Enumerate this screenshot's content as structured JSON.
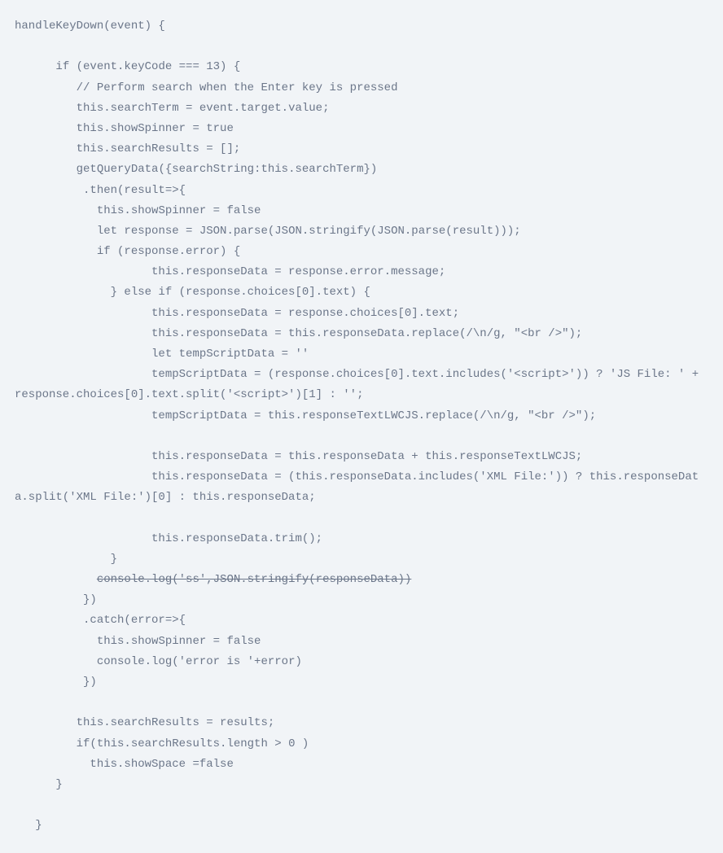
{
  "code": {
    "lines": [
      "handleKeyDown(event) {",
      "",
      "      if (event.keyCode === 13) {",
      "         // Perform search when the Enter key is pressed",
      "         this.searchTerm = event.target.value;",
      "         this.showSpinner = true",
      "         this.searchResults = [];",
      "         getQueryData({searchString:this.searchTerm})",
      "          .then(result=>{",
      "            this.showSpinner = false",
      "            let response = JSON.parse(JSON.stringify(JSON.parse(result)));",
      "            if (response.error) {",
      "                    this.responseData = response.error.message;",
      "              } else if (response.choices[0].text) {",
      "                    this.responseData = response.choices[0].text;",
      "                    this.responseData = this.responseData.replace(/\\n/g, \"<br />\");",
      "                    let tempScriptData = ''",
      "                    tempScriptData = (response.choices[0].text.includes('<script>')) ? 'JS File: ' + response.choices[0].text.split('<script>')[1] : '';",
      "                    tempScriptData = this.responseTextLWCJS.replace(/\\n/g, \"<br />\");",
      "",
      "                    this.responseData = this.responseData + this.responseTextLWCJS;",
      "                    this.responseData = (this.responseData.includes('XML File:')) ? this.responseData.split('XML File:')[0] : this.responseData;",
      "",
      "                    this.responseData.trim();",
      "              }",
      "            console.log('ss',JSON.stringify(responseData))",
      "          })",
      "          .catch(error=>{",
      "            this.showSpinner = false",
      "            console.log('error is '+error)",
      "          })",
      "",
      "         this.searchResults = results;",
      "         if(this.searchResults.length > 0 )",
      "           this.showSpace =false",
      "      }",
      "",
      "   }"
    ],
    "struck_line_index": 25
  }
}
